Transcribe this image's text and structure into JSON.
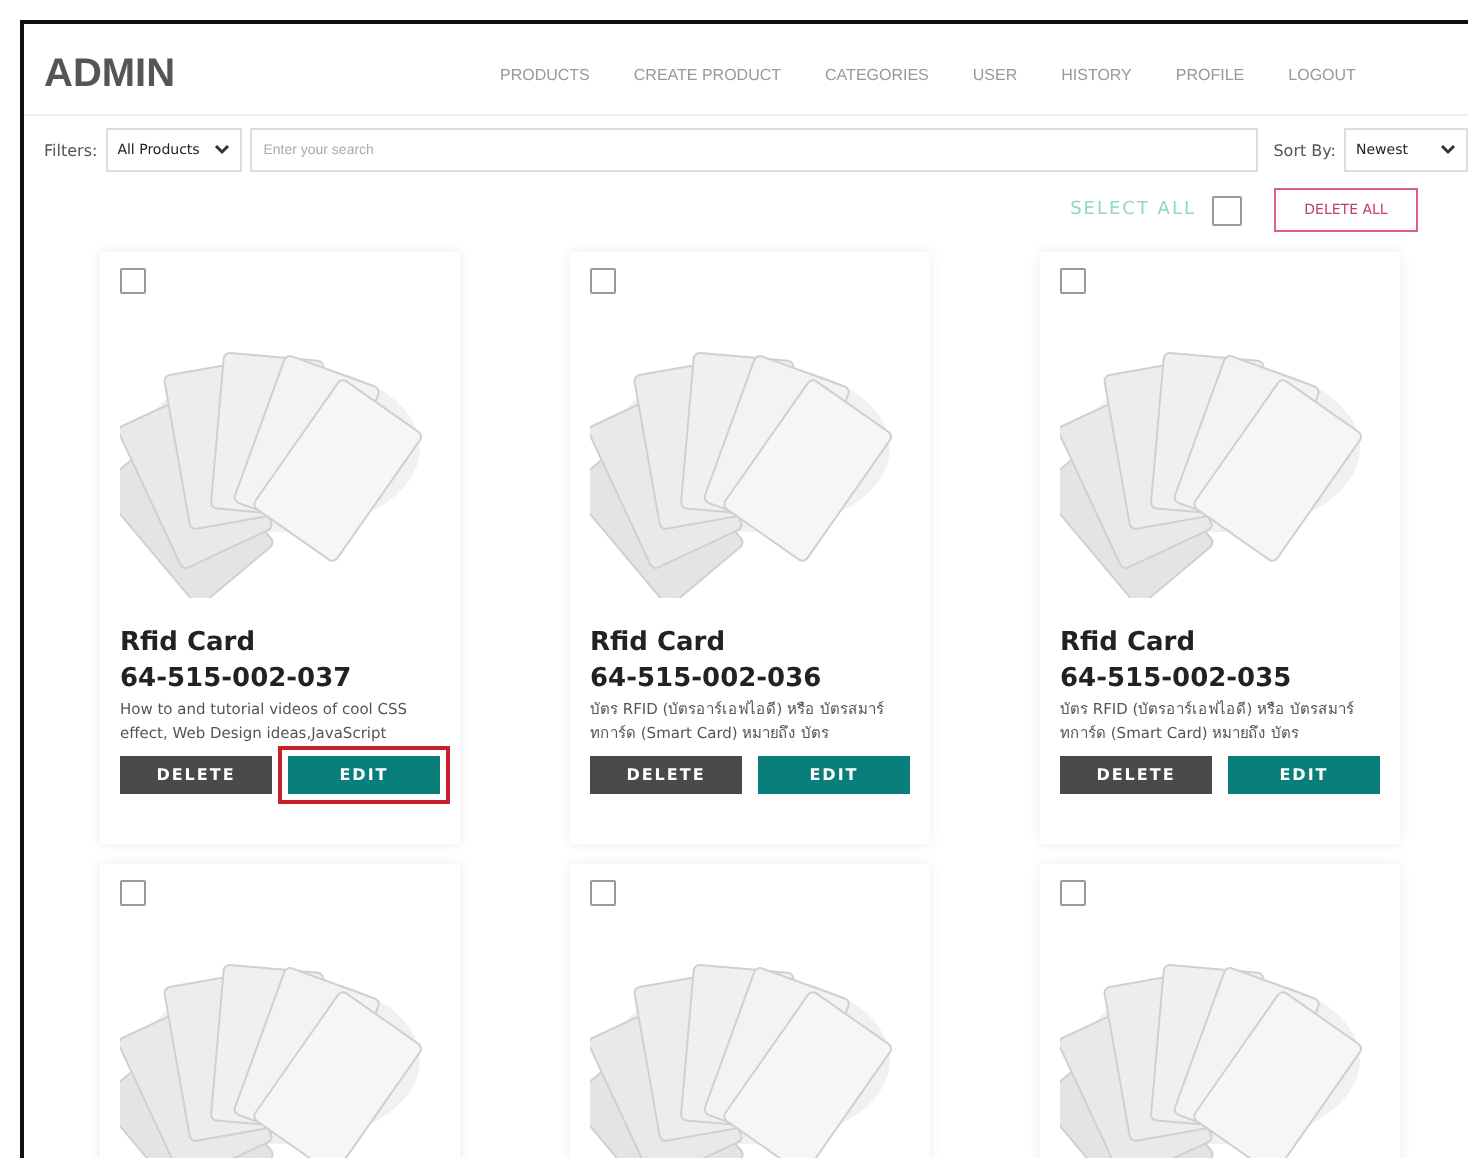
{
  "header": {
    "title": "ADMIN",
    "nav": [
      {
        "label": "PRODUCTS",
        "selected": false
      },
      {
        "label": "CREATE PRODUCT",
        "selected": false
      },
      {
        "label": "CATEGORIES",
        "selected": false
      },
      {
        "label": "USER",
        "selected": false
      },
      {
        "label": "HISTORY",
        "selected": false
      },
      {
        "label": "PROFILE",
        "selected": false
      },
      {
        "label": "LOGOUT",
        "selected": false
      }
    ]
  },
  "filters": {
    "label": "Filters:",
    "category": "All Products",
    "search_placeholder": "Enter your search",
    "sort_label": "Sort By:",
    "sort": "Newest"
  },
  "bulk": {
    "select_all": "SELECT ALL",
    "select_all_checked": false,
    "delete_all": "DELETE ALL"
  },
  "cards": [
    {
      "checked": false,
      "name": "Rfid Card",
      "code": "64-515-002-037",
      "description": "How to and tutorial videos of cool CSS effect, Web Design ideas,JavaScript",
      "delete": "DELETE",
      "edit": "EDIT",
      "edit_highlighted": true
    },
    {
      "checked": false,
      "name": "Rfid Card",
      "code": "64-515-002-036",
      "description": "บัตร RFID (บัตรอาร์เอฟไอดี) หรือ บัตรสมาร์ทการ์ด (Smart Card) หมายถึง บัตร",
      "delete": "DELETE",
      "edit": "EDIT",
      "edit_highlighted": false
    },
    {
      "checked": false,
      "name": "Rfid Card",
      "code": "64-515-002-035",
      "description": "บัตร RFID (บัตรอาร์เอฟไอดี) หรือ บัตรสมาร์ทการ์ด (Smart Card) หมายถึง บัตร",
      "delete": "DELETE",
      "edit": "EDIT",
      "edit_highlighted": false
    },
    {
      "checked": false
    },
    {
      "checked": false
    },
    {
      "checked": false
    }
  ]
}
